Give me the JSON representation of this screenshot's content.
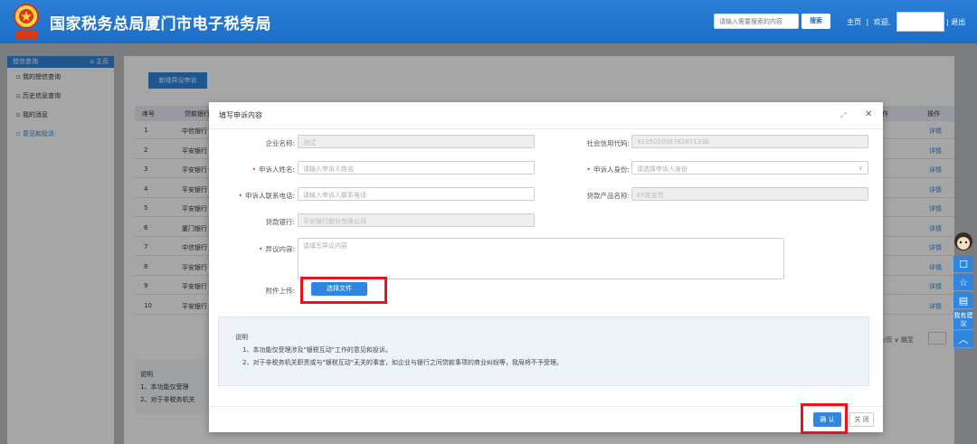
{
  "header": {
    "site_title": "国家税务总局厦门市电子税务局",
    "search_placeholder": "请输入需要搜索的内容",
    "search_button": "搜索",
    "home_link": "主页",
    "separator": "|",
    "welcome": "欢迎,",
    "logout": "退出",
    "brand_color": "#1d6ec6"
  },
  "sidebar": {
    "title": "授信查询",
    "home": "⌂ 主页",
    "items": [
      {
        "label": "我的授信查询"
      },
      {
        "label": "历史信息查询"
      },
      {
        "label": "我的消息"
      },
      {
        "label": "意见和投诉"
      }
    ]
  },
  "page": {
    "add_button": "新增异议申诉",
    "table": {
      "headers": [
        "序号",
        "贷款银行",
        "作",
        "操作"
      ],
      "rows": [
        {
          "no": "1",
          "bank": "中信银行",
          "op": "详情"
        },
        {
          "no": "2",
          "bank": "平安银行",
          "op": "详情"
        },
        {
          "no": "3",
          "bank": "平安银行",
          "op": "详情"
        },
        {
          "no": "4",
          "bank": "平安银行",
          "op": "详情"
        },
        {
          "no": "5",
          "bank": "平安银行",
          "op": "详情"
        },
        {
          "no": "6",
          "bank": "厦门银行",
          "op": "详情"
        },
        {
          "no": "7",
          "bank": "中信银行",
          "op": "详情"
        },
        {
          "no": "8",
          "bank": "平安银行",
          "op": "详情"
        },
        {
          "no": "9",
          "bank": "平安银行",
          "op": "详情"
        },
        {
          "no": "10",
          "bank": "平安银行",
          "op": "详情"
        }
      ]
    },
    "pager": "条/页 ∨  跳至",
    "bottom_note": {
      "title": "说明",
      "line1": "1、本功能仅受理",
      "line2": "2、对于非税务机关"
    }
  },
  "float_bar": {
    "item1": "☐",
    "item2": "☆",
    "item3": "▤",
    "feedback": "我有建议",
    "top": "︿"
  },
  "modal": {
    "title": "填写申诉内容",
    "fields": {
      "company_label": "企业名称:",
      "company_value": "测试",
      "credit_code_label": "社会信用代码:",
      "credit_code_value": "91350203678287133E",
      "name_label": "申诉人姓名:",
      "name_placeholder": "请输入申诉人姓名",
      "identity_label": "申诉人身份:",
      "identity_placeholder": "请选择申诉人身份",
      "phone_label": "申诉人联系电话:",
      "phone_placeholder": "请输入申诉人联系电话",
      "product_label": "贷款产品名称:",
      "product_value": "KY税金贷",
      "bank_label": "贷款银行:",
      "bank_value": "平安银行股份有限公司",
      "content_label": "异议内容:",
      "content_placeholder": "请填写异议内容",
      "attachment_label": "附件上传:",
      "file_button": "选择文件"
    },
    "info": {
      "title": "说明",
      "line1": "1、本功能仅受理涉及\"银税互动\"工作的意见和投诉。",
      "line2": "2、对于非税务机关职责或与\"银税互动\"无关的事宜，如企业与银行之间贷款事项的商业纠纷等，我局将不予受理。"
    },
    "confirm": "确 认",
    "close": "关 闭"
  }
}
